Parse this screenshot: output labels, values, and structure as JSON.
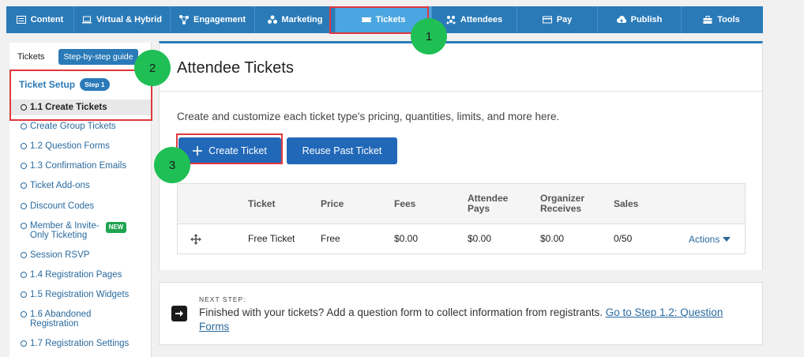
{
  "topnav": {
    "items": [
      {
        "label": "Content",
        "icon": "list-icon"
      },
      {
        "label": "Virtual & Hybrid",
        "icon": "laptop-icon"
      },
      {
        "label": "Engagement",
        "icon": "network-icon"
      },
      {
        "label": "Marketing",
        "icon": "groups-icon"
      },
      {
        "label": "Tickets",
        "icon": "ticket-icon",
        "active": true
      },
      {
        "label": "Attendees",
        "icon": "people-icon"
      },
      {
        "label": "Pay",
        "icon": "credit-card-icon"
      },
      {
        "label": "Publish",
        "icon": "cloud-upload-icon"
      },
      {
        "label": "Tools",
        "icon": "toolbox-icon"
      }
    ]
  },
  "annotations": [
    "1",
    "2",
    "3"
  ],
  "sidebar": {
    "tab": "Tickets",
    "guide_button": "Step-by-step guide",
    "section_title": "Ticket Setup",
    "step_badge": "Step 1",
    "items": [
      {
        "label": "1.1 Create Tickets"
      },
      {
        "label": "Create Group Tickets"
      },
      {
        "label": "1.2 Question Forms"
      },
      {
        "label": "1.3 Confirmation Emails"
      },
      {
        "label": "Ticket Add-ons"
      },
      {
        "label": "Discount Codes"
      },
      {
        "label": "Member & Invite-\nOnly Ticketing"
      },
      {
        "label": "Session RSVP"
      },
      {
        "label": "1.4 Registration Pages"
      },
      {
        "label": "1.5 Registration Widgets"
      },
      {
        "label": "1.6 Abandoned\nRegistration"
      },
      {
        "label": "1.7 Registration Settings"
      }
    ],
    "new_badge": "NEW"
  },
  "main": {
    "title": "Attendee Tickets",
    "description": "Create and customize each ticket type's pricing, quantities, limits, and more here.",
    "create_button": "Create Ticket",
    "reuse_button": "Reuse Past Ticket",
    "table": {
      "headers": [
        "Ticket",
        "Price",
        "Fees",
        "Attendee\nPays",
        "Organizer\nReceives",
        "Sales"
      ],
      "rows": [
        {
          "ticket": "Free Ticket",
          "price": "Free",
          "fees": "$0.00",
          "attendee_pays": "$0.00",
          "organizer_receives": "$0.00",
          "sales": "0/50",
          "actions": "Actions"
        }
      ]
    }
  },
  "next_step": {
    "label": "NEXT STEP:",
    "text": "Finished with your tickets? Add a question form to collect information from registrants. ",
    "link": "Go to Step 1.2: Question Forms"
  },
  "colors": {
    "accent": "#2a7ab8",
    "highlight": "#e0383e",
    "badge": "#1fbf55",
    "button": "#2268b8"
  }
}
